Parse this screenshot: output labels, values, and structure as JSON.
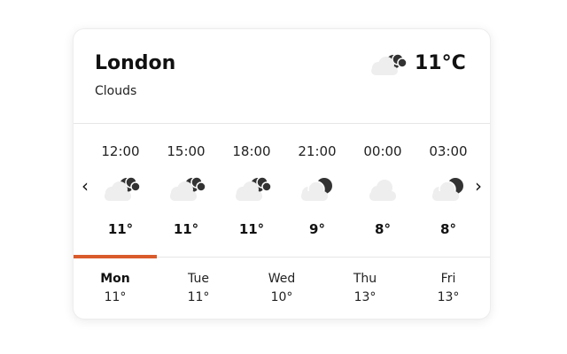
{
  "location": {
    "city": "London",
    "condition": "Clouds"
  },
  "current": {
    "temp": "11°C",
    "icon": "cloud-moon-cloud-icon"
  },
  "nav": {
    "prev": "‹",
    "next": "›"
  },
  "hourly": [
    {
      "time": "12:00",
      "temp": "11°",
      "icon": "cloud-moon-cloud-icon"
    },
    {
      "time": "15:00",
      "temp": "11°",
      "icon": "cloud-moon-cloud-icon"
    },
    {
      "time": "18:00",
      "temp": "11°",
      "icon": "cloud-moon-cloud-icon"
    },
    {
      "time": "21:00",
      "temp": "9°",
      "icon": "cloud-moon-icon"
    },
    {
      "time": "00:00",
      "temp": "8°",
      "icon": "cloud-icon"
    },
    {
      "time": "03:00",
      "temp": "8°",
      "icon": "cloud-moon-icon"
    }
  ],
  "days": [
    {
      "name": "Mon",
      "temp": "11°",
      "active": true
    },
    {
      "name": "Tue",
      "temp": "11°",
      "active": false
    },
    {
      "name": "Wed",
      "temp": "10°",
      "active": false
    },
    {
      "name": "Thu",
      "temp": "13°",
      "active": false
    },
    {
      "name": "Fri",
      "temp": "13°",
      "active": false
    }
  ],
  "colors": {
    "accent": "#d95b2b",
    "moon": "#333333",
    "cloud": "#eeeeee"
  }
}
